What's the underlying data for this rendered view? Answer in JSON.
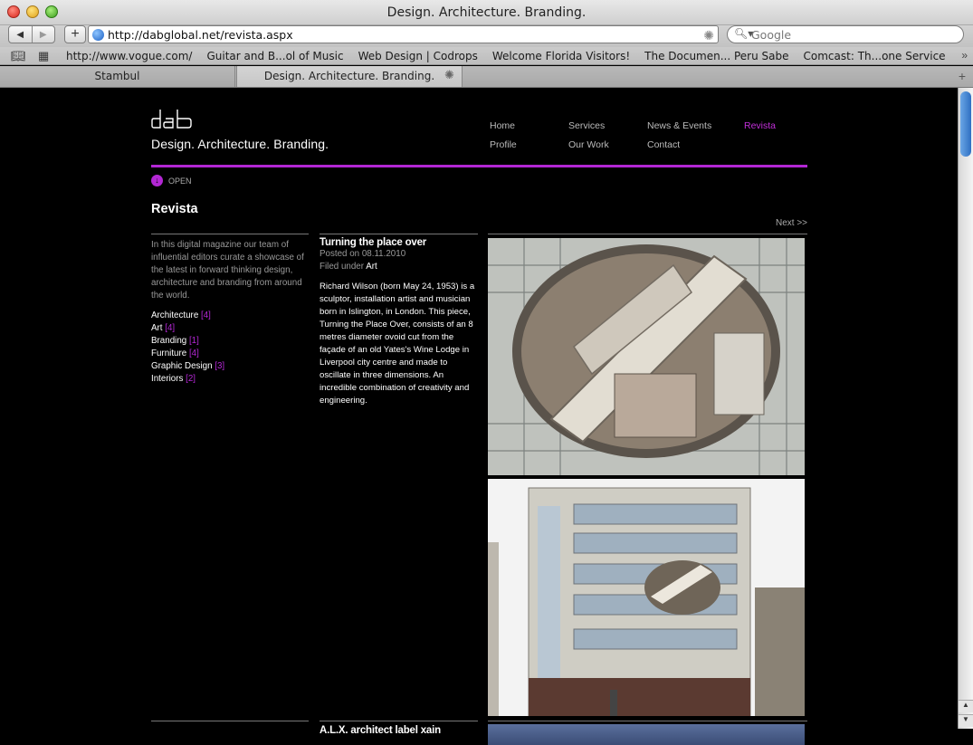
{
  "browser": {
    "window_title": "Design. Architecture. Branding.",
    "url": "http://dabglobal.net/revista.aspx",
    "search_placeholder": "Google",
    "bookmarks": [
      "http://www.vogue.com/",
      "Guitar and B...ol of Music",
      "Web Design | Codrops",
      "Welcome Florida Visitors!",
      "The Documen... Peru Sabe",
      "Comcast: Th...one Service"
    ],
    "tabs": [
      {
        "label": "Stambul"
      },
      {
        "label": "Design. Architecture. Branding."
      }
    ]
  },
  "site": {
    "logo_text": "dab",
    "tagline": "Design. Architecture. Branding.",
    "nav": [
      {
        "label": "Home"
      },
      {
        "label": "Services"
      },
      {
        "label": "News & Events"
      },
      {
        "label": "Revista"
      },
      {
        "label": "Profile"
      },
      {
        "label": "Our Work"
      },
      {
        "label": "Contact"
      }
    ],
    "accent_color": "#b327d4",
    "open_label": "OPEN",
    "page_title": "Revista",
    "next_label": "Next >>",
    "intro": "In this digital magazine our team of influential editors curate a showcase of the latest in forward thinking design, architecture and branding from around the world.",
    "categories": [
      {
        "name": "Architecture",
        "count": "[4]"
      },
      {
        "name": "Art",
        "count": "[4]"
      },
      {
        "name": "Branding",
        "count": "[1]"
      },
      {
        "name": "Furniture",
        "count": "[4]"
      },
      {
        "name": "Graphic Design",
        "count": "[3]"
      },
      {
        "name": "Interiors",
        "count": "[2]"
      }
    ],
    "article": {
      "title": "Turning the place over",
      "posted": "Posted on 08.11.2010",
      "filed_prefix": "Filed under",
      "filed_category": "Art",
      "body": "Richard Wilson (born May 24, 1953) is a sculptor, installation artist and musician born in Islington, in London. This piece, Turning the Place Over, consists of an 8 metres diameter ovoid cut from the façade of an old Yates's Wine Lodge in Liverpool city centre and made to oscillate in three dimensions. An incredible combination of creativity and engineering."
    },
    "next_article_title": "A.L.X. architect label xain"
  }
}
